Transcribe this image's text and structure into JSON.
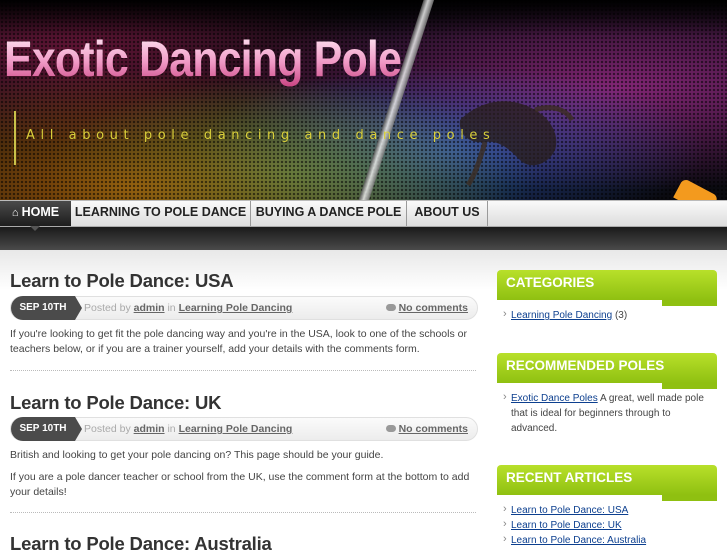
{
  "header": {
    "site_title": "Exotic Dancing Pole",
    "tagline": "All about pole dancing and dance poles"
  },
  "nav": {
    "items": [
      {
        "label": "HOME",
        "icon": "home-icon",
        "active": true
      },
      {
        "label": "LEARNING TO POLE DANCE"
      },
      {
        "label": "BUYING A DANCE POLE"
      },
      {
        "label": "ABOUT US"
      }
    ]
  },
  "posts": [
    {
      "title": "Learn to Pole Dance: USA",
      "date": "SEP 10TH",
      "posted_by_label": "Posted by",
      "author": "admin",
      "in_label": "in",
      "category": "Learning Pole Dancing",
      "comments": "No comments",
      "excerpt": [
        "If you're looking to get fit the pole dancing way and you're in the USA, look to one of the schools or teachers below, or if you are a trainer yourself, add your details with the comments form."
      ]
    },
    {
      "title": "Learn to Pole Dance: UK",
      "date": "SEP 10TH",
      "posted_by_label": "Posted by",
      "author": "admin",
      "in_label": "in",
      "category": "Learning Pole Dancing",
      "comments": "No comments",
      "excerpt": [
        "British and looking to get your pole dancing on? This page should be your guide.",
        "If you are a pole dancer teacher or school from the UK, use the comment form at the bottom to add your details!"
      ]
    },
    {
      "title": "Learn to Pole Dance: Australia"
    }
  ],
  "sidebar": {
    "categories": {
      "title": "CATEGORIES",
      "items": [
        {
          "label": "Learning Pole Dancing",
          "count": "(3)"
        }
      ]
    },
    "recommended": {
      "title": "RECOMMENDED POLES",
      "item_link": "Exotic Dance Poles",
      "item_text": " A great, well made pole that is ideal for beginners through to advanced."
    },
    "recent": {
      "title": "RECENT ARTICLES",
      "items": [
        "Learn to Pole Dance: USA",
        "Learn to Pole Dance: UK",
        "Learn to Pole Dance: Australia"
      ]
    }
  },
  "colors": {
    "accent_green": "#9fcf1c",
    "title_pink": "#f09ac6",
    "tagline_yellow": "#d9cf3a",
    "link_blue": "#0c3f8f"
  }
}
